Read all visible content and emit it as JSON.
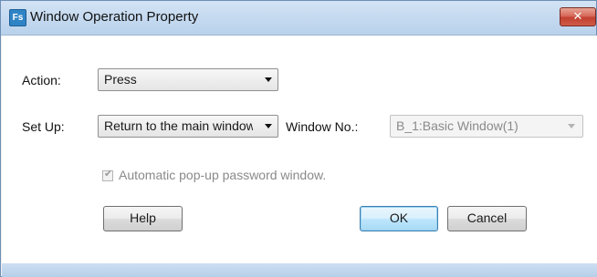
{
  "window": {
    "app_icon": "Fs",
    "title": "Window Operation Property",
    "close_glyph": "✕"
  },
  "form": {
    "action_label": "Action:",
    "action_value": "Press",
    "setup_label": "Set Up:",
    "setup_value": "Return to the main window",
    "window_no_label": "Window No.:",
    "window_no_value": "B_1:Basic Window(1)",
    "window_no_disabled": true,
    "auto_popup_label": "Automatic pop-up password window.",
    "auto_popup_checked": true,
    "auto_popup_disabled": true
  },
  "buttons": {
    "help": "Help",
    "ok": "OK",
    "cancel": "Cancel"
  }
}
